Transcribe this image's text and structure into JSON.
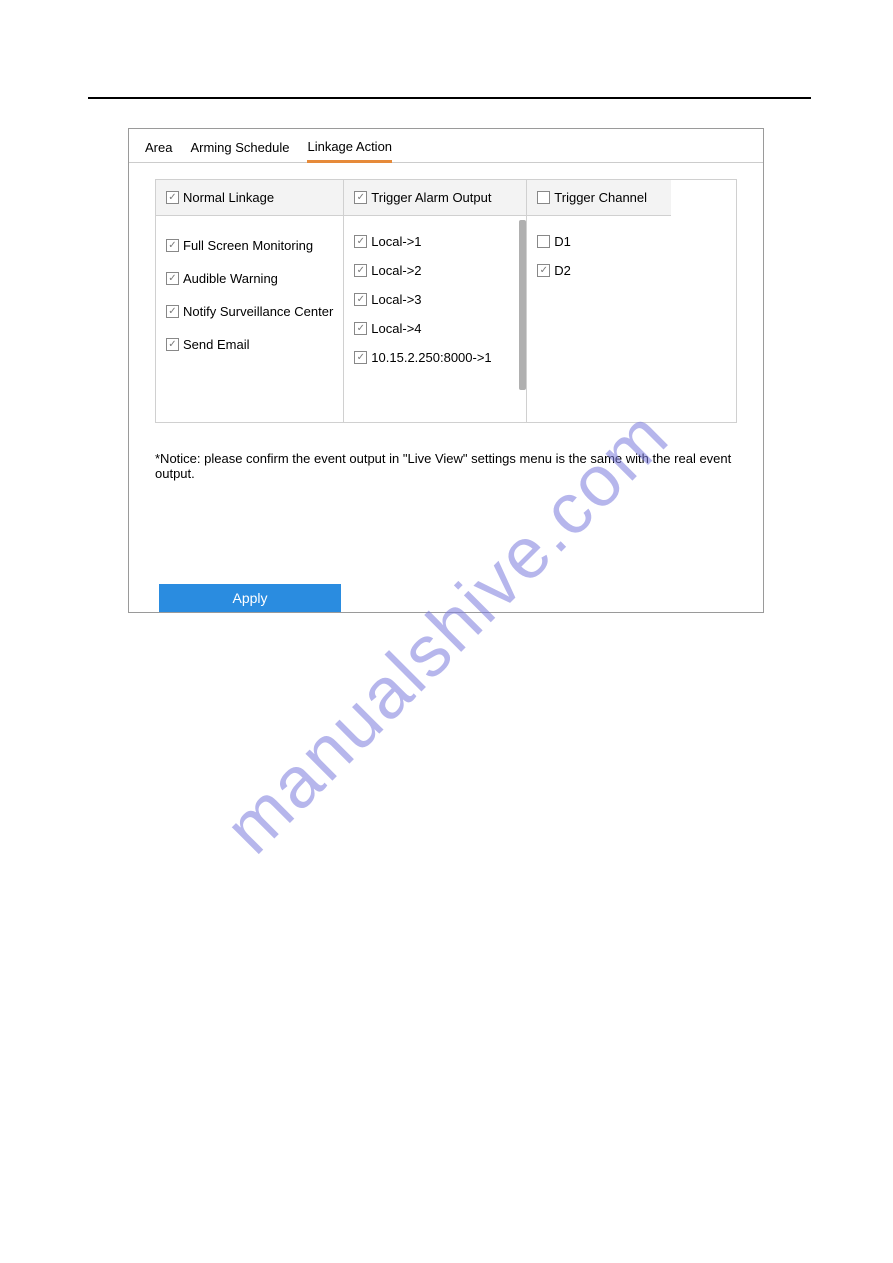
{
  "tabs": {
    "area": "Area",
    "arming_schedule": "Arming Schedule",
    "linkage_action": "Linkage Action"
  },
  "columns": {
    "normal_linkage": {
      "header": "Normal Linkage",
      "items": {
        "fullscreen": "Full Screen Monitoring",
        "audible": "Audible Warning",
        "notify": "Notify Surveillance Center",
        "email": "Send Email"
      }
    },
    "trigger_output": {
      "header": "Trigger Alarm Output",
      "items": {
        "l1": "Local->1",
        "l2": "Local->2",
        "l3": "Local->3",
        "l4": "Local->4",
        "ip": "10.15.2.250:8000->1"
      }
    },
    "trigger_channel": {
      "header": "Trigger Channel",
      "items": {
        "d1": "D1",
        "d2": "D2"
      }
    }
  },
  "notice": "*Notice: please confirm the event output in \"Live View\" settings menu is the same with the real event output.",
  "apply": "Apply",
  "watermark": "manualshive.com"
}
